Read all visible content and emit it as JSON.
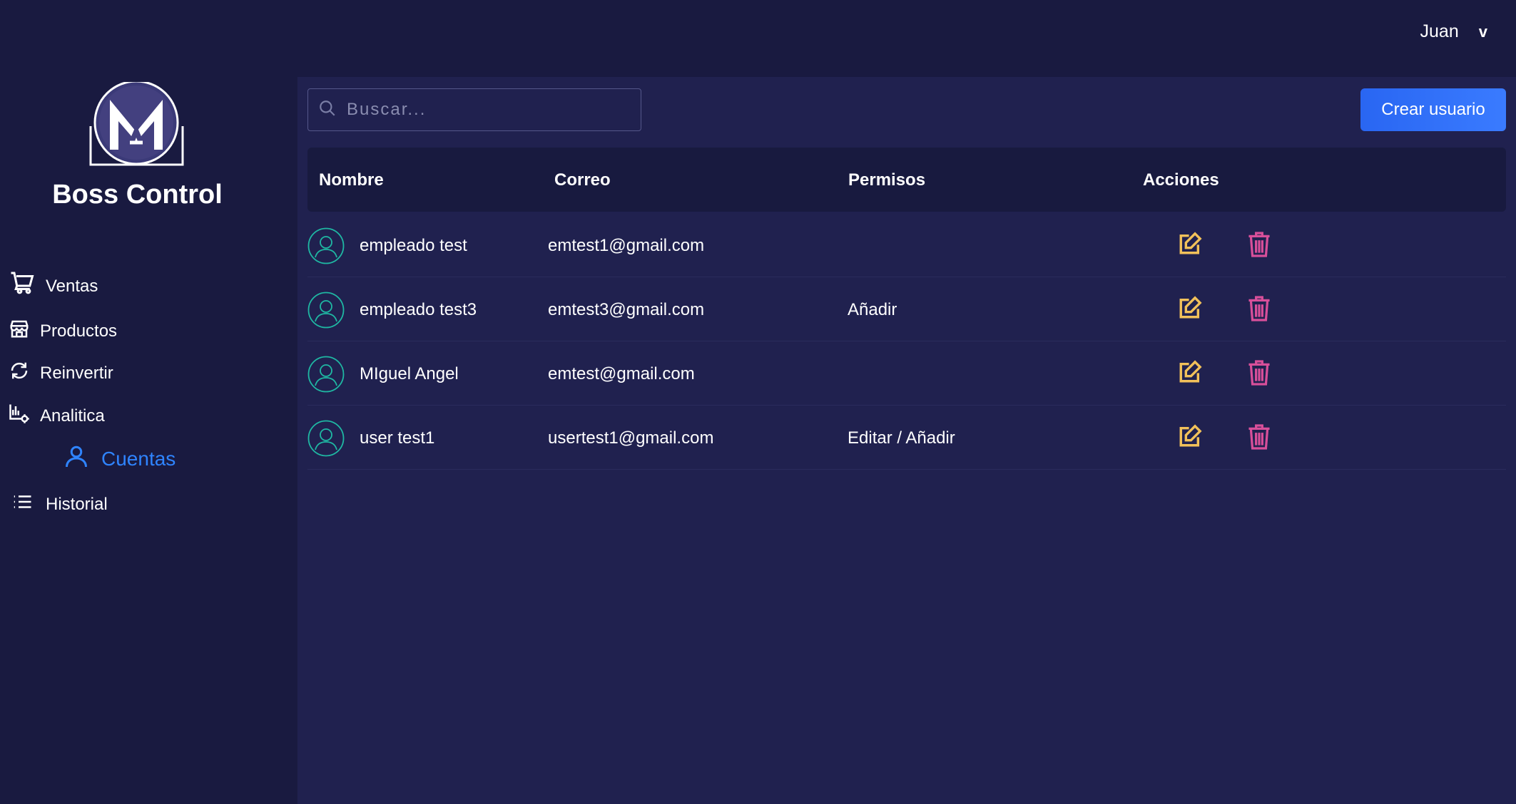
{
  "user": {
    "name": "Juan",
    "menu_chevron": "v"
  },
  "brand": {
    "name": "Boss Control",
    "logo_icon": "boss-control-logo"
  },
  "sidebar": {
    "items": [
      {
        "label": "Ventas",
        "icon": "cart-icon"
      },
      {
        "label": "Productos",
        "icon": "store-icon"
      },
      {
        "label": "Reinvertir",
        "icon": "refresh-icon"
      },
      {
        "label": "Analitica",
        "icon": "analytics-icon"
      },
      {
        "label": "Cuentas",
        "icon": "user-icon",
        "active": true
      },
      {
        "label": "Historial",
        "icon": "list-icon"
      }
    ]
  },
  "search": {
    "placeholder": "Buscar...",
    "value": ""
  },
  "create_button": {
    "label": "Crear usuario"
  },
  "table": {
    "headers": [
      "Nombre",
      "Correo",
      "Permisos",
      "Acciones"
    ],
    "rows": [
      {
        "name": "empleado test",
        "email": "emtest1@gmail.com",
        "permissions": ""
      },
      {
        "name": "empleado test3",
        "email": "emtest3@gmail.com",
        "permissions": "Añadir"
      },
      {
        "name": "MIguel Angel",
        "email": "emtest@gmail.com",
        "permissions": ""
      },
      {
        "name": "user test1",
        "email": "usertest1@gmail.com",
        "permissions": "Editar / Añadir"
      }
    ]
  },
  "colors": {
    "background": "#191a40",
    "main_panel": "#20214f",
    "accent": "#2f84ff",
    "avatar": "#1fb8a3",
    "edit": "#f2c15a",
    "delete": "#d84f9a"
  }
}
